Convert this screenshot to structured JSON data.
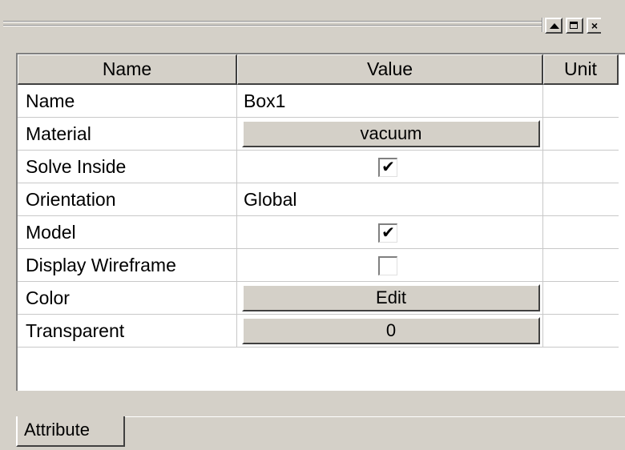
{
  "columns": {
    "name": "Name",
    "value": "Value",
    "unit": "Unit"
  },
  "window_buttons": [
    {
      "name": "restore-up",
      "icon": "triangle-up-icon"
    },
    {
      "name": "maximize",
      "icon": "maximize-icon"
    },
    {
      "name": "close",
      "label": "×",
      "icon": "close-icon"
    }
  ],
  "rows": [
    {
      "name": "Name",
      "kind": "text",
      "value": "Box1",
      "unit": ""
    },
    {
      "name": "Material",
      "kind": "button",
      "value": "vacuum",
      "unit": ""
    },
    {
      "name": "Solve Inside",
      "kind": "checkbox",
      "checked": true,
      "mark": "✔",
      "unit": ""
    },
    {
      "name": "Orientation",
      "kind": "text",
      "value": "Global",
      "unit": ""
    },
    {
      "name": "Model",
      "kind": "checkbox",
      "checked": true,
      "mark": "✔",
      "unit": ""
    },
    {
      "name": "Display Wireframe",
      "kind": "checkbox",
      "checked": false,
      "mark": "",
      "unit": ""
    },
    {
      "name": "Color",
      "kind": "button",
      "value": "Edit",
      "unit": ""
    },
    {
      "name": "Transparent",
      "kind": "button",
      "value": "0",
      "unit": ""
    }
  ],
  "tab": {
    "label": "Attribute"
  }
}
